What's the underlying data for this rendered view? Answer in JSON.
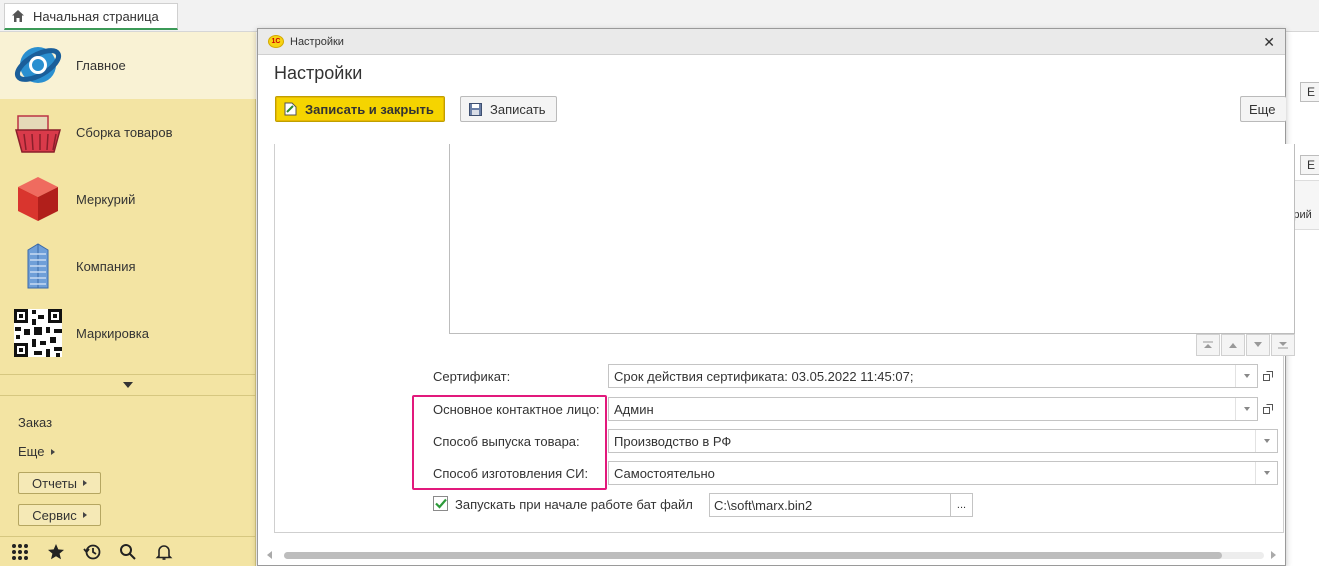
{
  "topbar": {
    "home_tab": "Начальная страница"
  },
  "sidebar": {
    "items": [
      {
        "label": "Главное",
        "icon": "globe-icon"
      },
      {
        "label": "Сборка товаров",
        "icon": "basket-icon"
      },
      {
        "label": "Меркурий",
        "icon": "cube-icon"
      },
      {
        "label": "Компания",
        "icon": "building-icon"
      },
      {
        "label": "Маркировка",
        "icon": "qr-code-icon"
      }
    ],
    "links": {
      "order": "Заказ",
      "more": "Еще"
    },
    "buttons": {
      "reports": "Отчеты",
      "service": "Сервис"
    }
  },
  "dialog": {
    "window_title": "Настройки",
    "heading": "Настройки",
    "toolbar": {
      "save_close": "Записать и закрыть",
      "save": "Записать",
      "more": "Еще"
    },
    "fields": {
      "certificate": {
        "label": "Сертификат:",
        "value": "Срок действия сертификата: 03.05.2022 11:45:07;"
      },
      "contact": {
        "label": "Основное контактное лицо:",
        "value": "Админ"
      },
      "release_method": {
        "label": "Способ выпуска товара:",
        "value": "Производство в РФ"
      },
      "manufacture_method": {
        "label": "Способ изготовления СИ:",
        "value": "Самостоятельно"
      }
    },
    "launch": {
      "label": "Запускать при начале работе бат файл",
      "checked": true,
      "path": "C:\\soft\\marx.bin2",
      "browse": "..."
    }
  },
  "background": {
    "btn1": "Е",
    "btn2": "Е",
    "col_text": "урий"
  },
  "colors": {
    "accent_yellow": "#f5d400",
    "sidebar_bg": "#f3e4a3",
    "highlight": "#e2197c",
    "tab_green": "#3b9a57"
  }
}
